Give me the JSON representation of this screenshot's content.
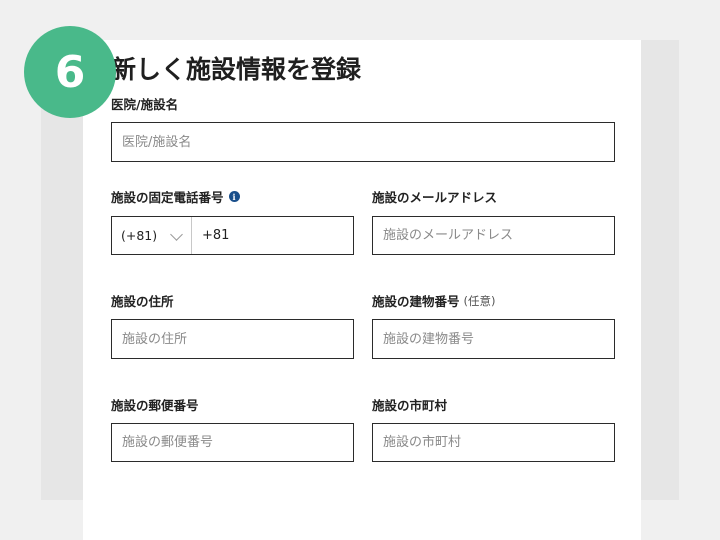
{
  "step": {
    "number": "6"
  },
  "title": "新しく施設情報を登録",
  "fields": {
    "facility_name": {
      "label": "医院/施設名",
      "placeholder": "医院/施設名"
    },
    "phone": {
      "label": "施設の固定電話番号",
      "info_icon": "info-icon",
      "country_code": "(+81)",
      "value": "+81"
    },
    "email": {
      "label": "施設のメールアドレス",
      "placeholder": "施設のメールアドレス"
    },
    "address": {
      "label": "施設の住所",
      "placeholder": "施設の住所"
    },
    "building": {
      "label": "施設の建物番号",
      "optional": "(任意)",
      "placeholder": "施設の建物番号"
    },
    "postal": {
      "label": "施設の郵便番号",
      "placeholder": "施設の郵便番号"
    },
    "city": {
      "label": "施設の市町村",
      "placeholder": "施設の市町村"
    }
  },
  "colors": {
    "badge": "#49b98a",
    "info_icon": "#1a4f8b",
    "background": "#f0f0f0",
    "panel": "#e6e6e6"
  }
}
